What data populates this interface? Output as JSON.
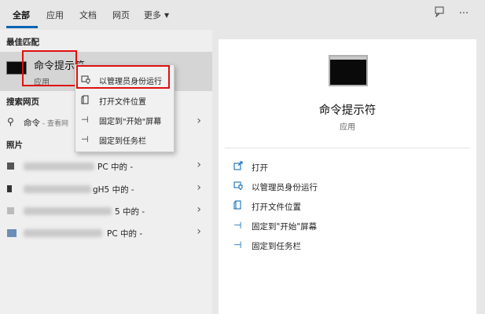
{
  "tabs": [
    "全部",
    "应用",
    "文档",
    "网页",
    "更多"
  ],
  "header_icons": {
    "feedback": "feedback-icon",
    "more": "ellipsis-icon"
  },
  "sections": {
    "best": "最佳匹配",
    "web": "搜索网页",
    "photos": "照片"
  },
  "best_match": {
    "title": "命令提示符",
    "subtitle": "应用"
  },
  "web_result": {
    "label": "命令",
    "suffix": " - 查看网"
  },
  "photo_results": [
    {
      "suffix": "PC 中的 -"
    },
    {
      "suffix": "gH5 中的 -"
    },
    {
      "suffix": "5 中的 -"
    },
    {
      "suffix": "PC 中的 -"
    }
  ],
  "context_menu": [
    {
      "label": "以管理员身份运行",
      "icon": "shield-icon"
    },
    {
      "label": "打开文件位置",
      "icon": "folder-icon"
    },
    {
      "label": "固定到\"开始\"屏幕",
      "icon": "pin-icon"
    },
    {
      "label": "固定到任务栏",
      "icon": "pin-icon"
    }
  ],
  "detail": {
    "title": "命令提示符",
    "subtitle": "应用",
    "actions": [
      {
        "label": "打开",
        "icon": "open-icon"
      },
      {
        "label": "以管理员身份运行",
        "icon": "shield-icon"
      },
      {
        "label": "打开文件位置",
        "icon": "folder-icon"
      },
      {
        "label": "固定到\"开始\"屏幕",
        "icon": "pin-icon"
      },
      {
        "label": "固定到任务栏",
        "icon": "pin-icon"
      }
    ]
  },
  "colors": {
    "accent": "#0063b1",
    "highlight": "#e01010"
  }
}
